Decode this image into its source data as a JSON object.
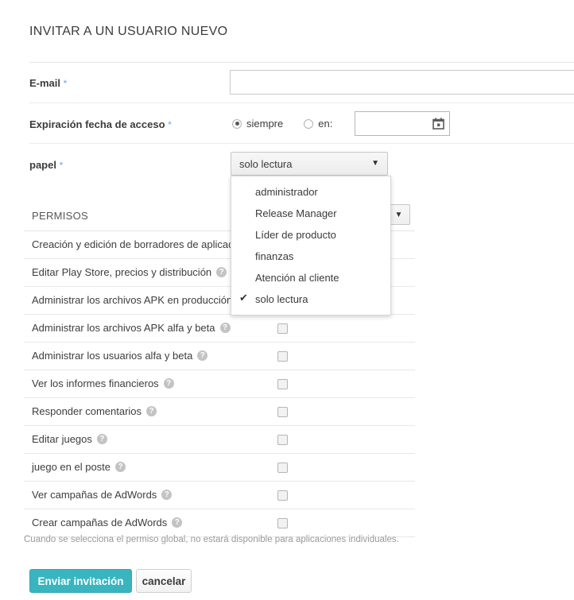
{
  "page": {
    "title": "INVITAR A UN USUARIO NUEVO",
    "required_marker": "*"
  },
  "fields": {
    "email": {
      "label": "E-mail",
      "value": "",
      "placeholder": ""
    },
    "expiration": {
      "label": "Expiración fecha de acceso",
      "options": [
        {
          "label": "siempre",
          "selected": true
        },
        {
          "label": "en:",
          "selected": false
        }
      ],
      "date_value": "",
      "date_icon": "calendar-icon"
    },
    "role": {
      "label": "papel",
      "selected": "solo lectura",
      "caret": "▼",
      "options": [
        {
          "label": "administrador",
          "checked": false
        },
        {
          "label": "Release Manager",
          "checked": false
        },
        {
          "label": "Líder de producto",
          "checked": false
        },
        {
          "label": "finanzas",
          "checked": false
        },
        {
          "label": "Atención al cliente",
          "checked": false
        },
        {
          "label": "solo lectura",
          "checked": true
        }
      ],
      "check_glyph": "✔"
    }
  },
  "permissions": {
    "header": "PERMISOS",
    "header_select_caret": "▼",
    "help_glyph": "?",
    "rows": [
      {
        "label": "Creación y edición de borradores de aplicaciones",
        "checked": false
      },
      {
        "label": "Editar Play Store, precios y distribución",
        "checked": false
      },
      {
        "label": "Administrar los archivos APK en producción",
        "checked": false
      },
      {
        "label": "Administrar los archivos APK alfa y beta",
        "checked": false
      },
      {
        "label": "Administrar los usuarios alfa y beta",
        "checked": false
      },
      {
        "label": "Ver los informes financieros",
        "checked": false
      },
      {
        "label": "Responder comentarios",
        "checked": false
      },
      {
        "label": "Editar juegos",
        "checked": false
      },
      {
        "label": "juego en el poste",
        "checked": false
      },
      {
        "label": "Ver campañas de AdWords",
        "checked": false
      },
      {
        "label": "Crear campañas de AdWords",
        "checked": false
      }
    ],
    "note": "Cuando se selecciona el permiso global, no estará disponible para aplicaciones individuales."
  },
  "footer": {
    "submit_label": "Enviar invitación",
    "cancel_label": "cancelar"
  },
  "colors": {
    "accent": "#39b5c0",
    "required": "#6ba4e7",
    "text": "#3c3c3c",
    "muted": "#9a9a9a"
  }
}
